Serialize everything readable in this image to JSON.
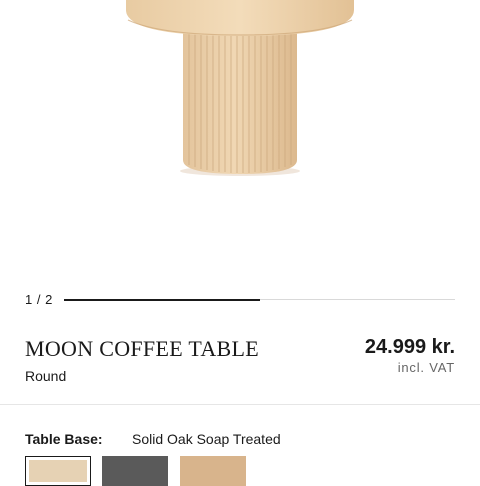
{
  "gallery": {
    "counter": "1 / 2",
    "progress": 0.5
  },
  "product": {
    "title": "MOON COFFEE TABLE",
    "variant": "Round",
    "price": "24.999 kr.",
    "price_note": "incl. VAT"
  },
  "options": {
    "label": "Table Base:",
    "selected_value": "Solid Oak Soap Treated",
    "swatches": [
      {
        "name": "oak-light",
        "color": "#e6d2b4",
        "selected": true
      },
      {
        "name": "dark-grey",
        "color": "#5a5a5a",
        "selected": false
      },
      {
        "name": "oak-warm",
        "color": "#d8b48c",
        "selected": false
      }
    ]
  },
  "colors": {
    "text": "#1a1a1a",
    "oak": "#e8cfa6",
    "divider": "#e6e6e6"
  }
}
